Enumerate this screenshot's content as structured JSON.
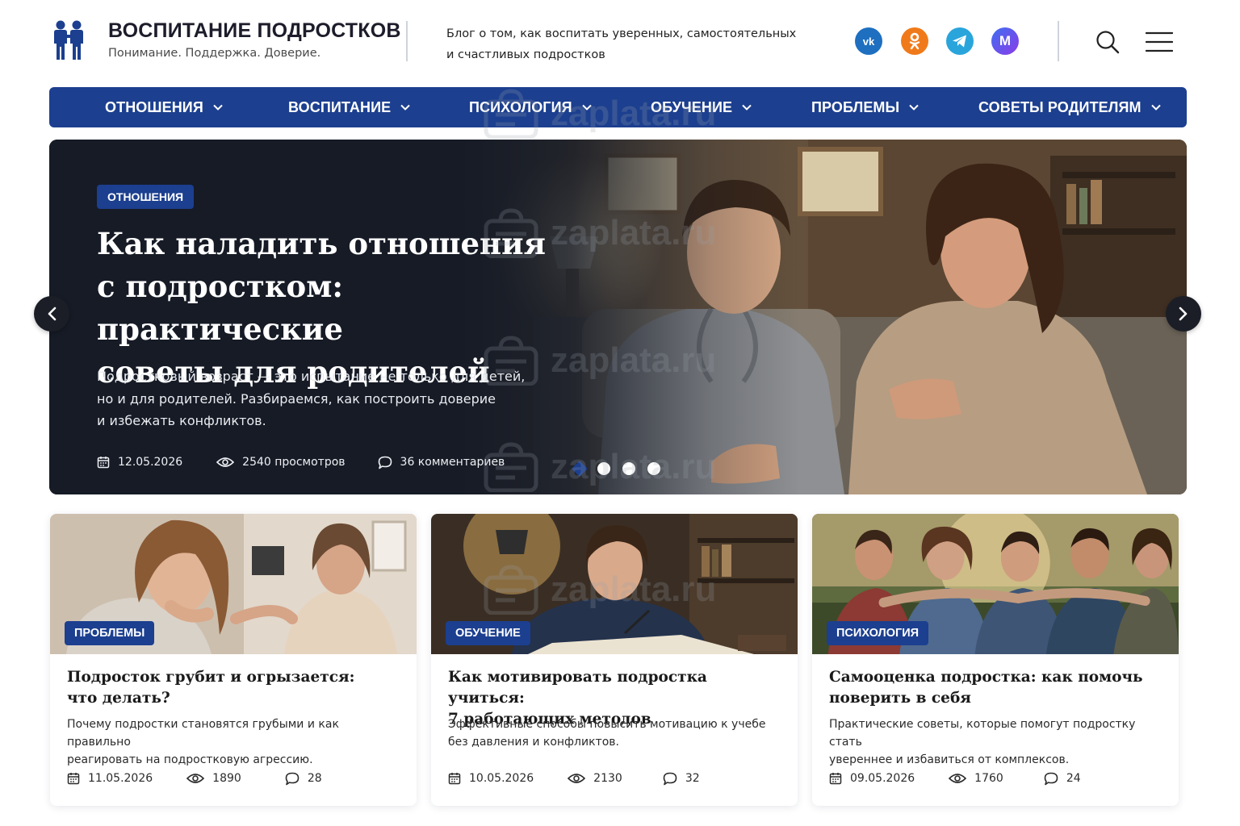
{
  "header": {
    "site_title": "ВОСПИТАНИЕ ПОДРОСТКОВ",
    "tagline": "Понимание. Поддержка. Доверие.",
    "description_line1": "Блог о том, как воспитать уверенных, самостоятельных",
    "description_line2": "и счастливых подростков",
    "social": [
      {
        "name": "vk",
        "label": "vk",
        "icon": "vk-icon",
        "color": "#1e6fc0"
      },
      {
        "name": "ok",
        "icon": "odnoklassniki-icon",
        "color": "#f07a1a"
      },
      {
        "name": "telegram",
        "icon": "telegram-icon",
        "color": "#2aa5dc"
      },
      {
        "name": "max",
        "label": "M",
        "icon": "max-icon",
        "color": "#5b4ef0"
      }
    ]
  },
  "nav": {
    "items": [
      {
        "label": "ОТНОШЕНИЯ"
      },
      {
        "label": "ВОСПИТАНИЕ"
      },
      {
        "label": "ПСИХОЛОГИЯ"
      },
      {
        "label": "ОБУЧЕНИЕ"
      },
      {
        "label": "ПРОБЛЕМЫ"
      },
      {
        "label": "СОВЕТЫ РОДИТЕЛЯМ"
      }
    ]
  },
  "hero": {
    "category": "ОТНОШЕНИЯ",
    "title_line1": "Как наладить отношения",
    "title_line2": "с подростком: практические",
    "title_line3": "советы для родителей",
    "lead_line1": "Подростковый возраст — это испытание не только для детей,",
    "lead_line2": "но и для родителей. Разбираемся, как построить доверие",
    "lead_line3": "и избежать конфликтов.",
    "date": "12.05.2026",
    "views": "2540 просмотров",
    "comments": "36 комментариев",
    "slides_total": 4,
    "active_slide": 1
  },
  "cards": [
    {
      "category": "ПРОБЛЕМЫ",
      "title_line1": "Подросток грубит и огрызается:",
      "title_line2": "что делать?",
      "desc_line1": "Почему подростки становятся грубыми и как правильно",
      "desc_line2": "реагировать на подростковую агрессию.",
      "date": "11.05.2026",
      "views": "1890",
      "comments": "28"
    },
    {
      "category": "ОБУЧЕНИЕ",
      "title_line1": "Как мотивировать подростка учиться:",
      "title_line2": "7 работающих методов",
      "desc_line1": "Эффективные способы повысить мотивацию к учебе",
      "desc_line2": "без давления и конфликтов.",
      "date": "10.05.2026",
      "views": "2130",
      "comments": "32"
    },
    {
      "category": "ПСИХОЛОГИЯ",
      "title_line1": "Самооценка подростка: как помочь",
      "title_line2": "поверить в себя",
      "desc_line1": "Практические советы, которые помогут подростку стать",
      "desc_line2": "увереннее и избавиться от комплексов.",
      "date": "09.05.2026",
      "views": "1760",
      "comments": "24"
    }
  ],
  "watermark": {
    "text": "zaplata.ru"
  },
  "colors": {
    "brand": "#1c3f8f",
    "hero_bg": "#161b26"
  }
}
